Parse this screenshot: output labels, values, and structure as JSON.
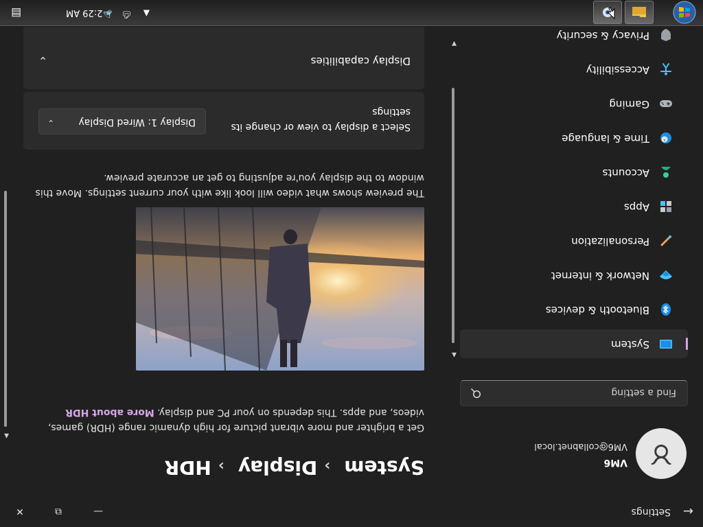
{
  "window": {
    "title": "Settings",
    "back": "←",
    "minimize": "—",
    "restore": "⧉",
    "close": "✕"
  },
  "user": {
    "name": "VM6",
    "email": "VM6@collabnet.local"
  },
  "search": {
    "placeholder": "Find a setting"
  },
  "nav": {
    "items": [
      {
        "label": "System",
        "icon": "monitor-icon",
        "active": true
      },
      {
        "label": "Bluetooth & devices",
        "icon": "bluetooth-icon"
      },
      {
        "label": "Network & internet",
        "icon": "wifi-icon"
      },
      {
        "label": "Personalization",
        "icon": "pen-icon"
      },
      {
        "label": "Apps",
        "icon": "apps-icon"
      },
      {
        "label": "Accounts",
        "icon": "person-icon"
      },
      {
        "label": "Time & language",
        "icon": "globe-clock-icon"
      },
      {
        "label": "Gaming",
        "icon": "gamepad-icon"
      },
      {
        "label": "Accessibility",
        "icon": "accessibility-icon"
      },
      {
        "label": "Privacy & security",
        "icon": "shield-icon"
      }
    ]
  },
  "breadcrumb": {
    "level1": "System",
    "level2": "Display",
    "level3": "HDR",
    "separator": "›"
  },
  "main": {
    "description": "Get a brighter and more vibrant picture for high dynamic range (HDR) games, videos, and apps. This depends on your PC and display.",
    "more_link": "More about HDR",
    "preview_text": "The preview shows what video will look like with your current settings. Move this window to the display you're adjusting to get an accurate preview.",
    "select_display_text": "Select a display to view or change its settings",
    "display_dropdown": "Display 1: Wired Display",
    "capabilities": "Display capabilities"
  },
  "taskbar": {
    "time": "2:29 AM"
  },
  "colors": {
    "accent": "#d6a5e6",
    "background": "#202020",
    "card": "#2b2b2b"
  }
}
